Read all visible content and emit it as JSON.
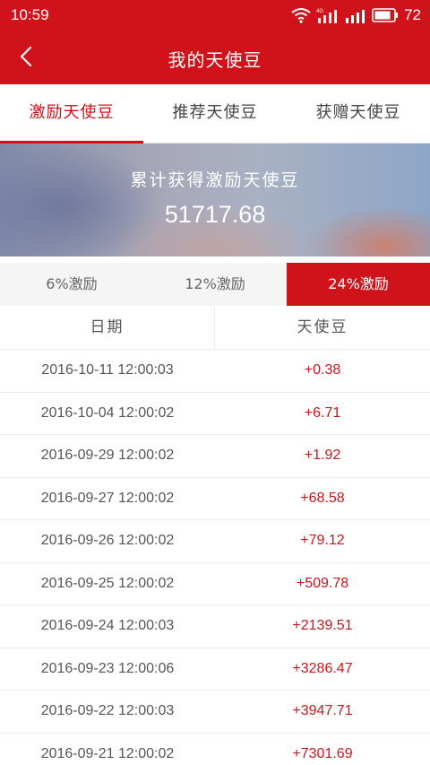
{
  "status_bar": {
    "time": "10:59",
    "network_label": "4G",
    "battery": "72",
    "icons": [
      "wifi-icon",
      "signal-icon",
      "battery-icon"
    ]
  },
  "header": {
    "title": "我的天使豆",
    "back_icon": "chevron-left-icon"
  },
  "tabs": [
    {
      "label": "激励天使豆",
      "active": true
    },
    {
      "label": "推荐天使豆",
      "active": false
    },
    {
      "label": "获赠天使豆",
      "active": false
    }
  ],
  "banner": {
    "caption": "累计获得激励天使豆",
    "amount": "51717.68"
  },
  "segments": [
    {
      "label": "6%激励",
      "active": false
    },
    {
      "label": "12%激励",
      "active": false
    },
    {
      "label": "24%激励",
      "active": true
    }
  ],
  "table": {
    "headers": [
      "日期",
      "天使豆"
    ],
    "rows": [
      {
        "date": "2016-10-11  12:00:03",
        "amount": "+0.38"
      },
      {
        "date": "2016-10-04  12:00:02",
        "amount": "+6.71"
      },
      {
        "date": "2016-09-29  12:00:02",
        "amount": "+1.92"
      },
      {
        "date": "2016-09-27  12:00:02",
        "amount": "+68.58"
      },
      {
        "date": "2016-09-26  12:00:02",
        "amount": "+79.12"
      },
      {
        "date": "2016-09-25  12:00:02",
        "amount": "+509.78"
      },
      {
        "date": "2016-09-24  12:00:03",
        "amount": "+2139.51"
      },
      {
        "date": "2016-09-23  12:00:06",
        "amount": "+3286.47"
      },
      {
        "date": "2016-09-22  12:00:03",
        "amount": "+3947.71"
      },
      {
        "date": "2016-09-21  12:00:02",
        "amount": "+7301.69"
      }
    ]
  },
  "colors": {
    "accent": "#d0121b",
    "amount_text": "#c8161e"
  }
}
